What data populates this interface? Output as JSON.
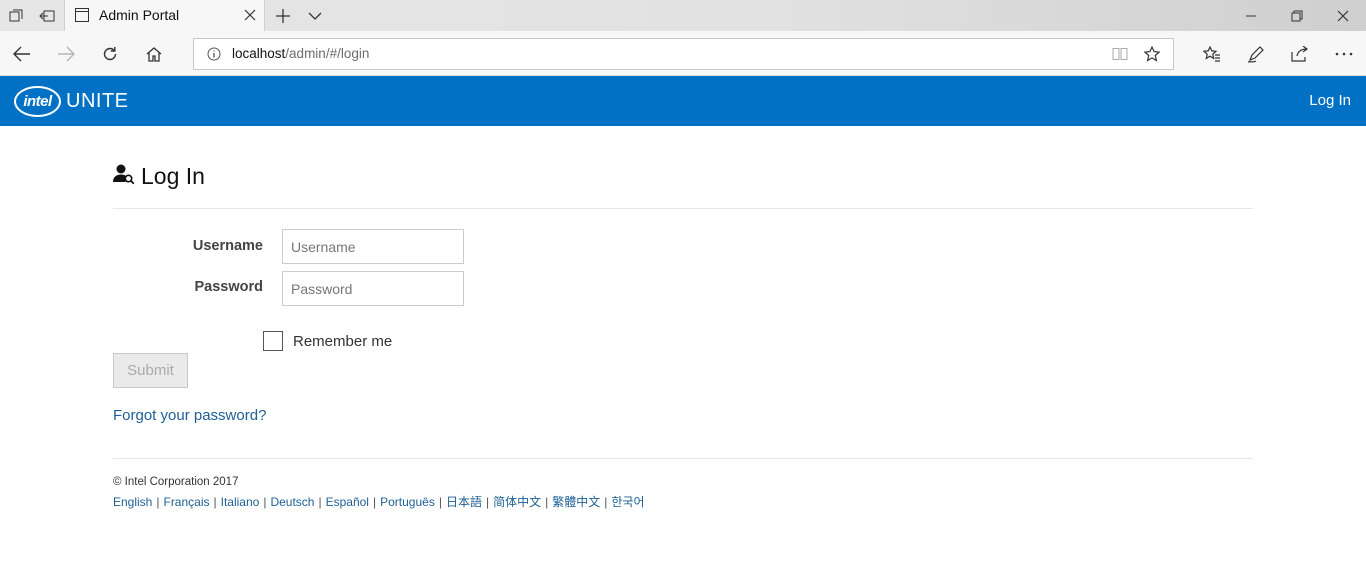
{
  "browser": {
    "tab_title": "Admin Portal",
    "address_host": "localhost",
    "address_path": "/admin/#/login"
  },
  "header": {
    "logo_intel": "intel",
    "logo_unite": "UNITE",
    "login_link": "Log In"
  },
  "login": {
    "title": "Log In",
    "username_label": "Username",
    "username_placeholder": "Username",
    "password_label": "Password",
    "password_placeholder": "Password",
    "remember_label": "Remember me",
    "submit_label": "Submit",
    "forgot_link": "Forgot your password?"
  },
  "footer": {
    "copyright": "© Intel Corporation 2017",
    "languages": [
      "English",
      "Français",
      "Italiano",
      "Deutsch",
      "Español",
      "Português",
      "日本語",
      "简体中文",
      "繁體中文",
      "한국어"
    ],
    "separator": "|"
  },
  "colors": {
    "brand_blue": "#0071c5",
    "link_blue": "#1e5f94"
  }
}
